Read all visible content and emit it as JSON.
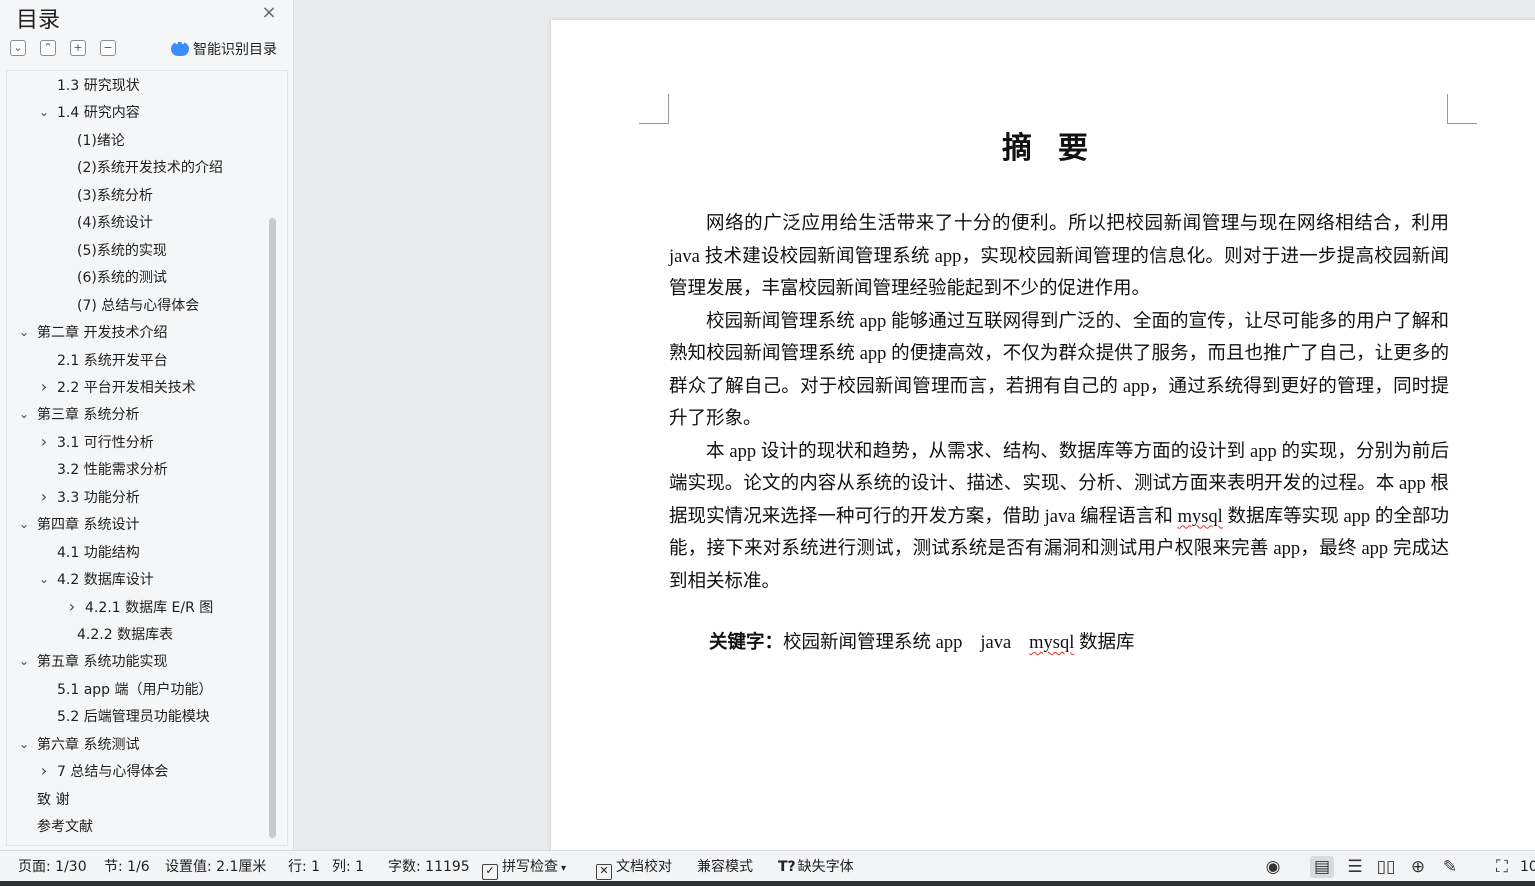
{
  "sidebar": {
    "title": "目录",
    "close_glyph": "×",
    "smart_toc_label": "智能识别目录",
    "toc": [
      {
        "label": "1.3  研究现状",
        "level": 1,
        "chevron": ""
      },
      {
        "label": "1.4  研究内容",
        "level": 1,
        "chevron": "expanded"
      },
      {
        "label": "(1)绪论",
        "level": 2,
        "chevron": ""
      },
      {
        "label": "(2)系统开发技术的介绍",
        "level": 2,
        "chevron": ""
      },
      {
        "label": "(3)系统分析",
        "level": 2,
        "chevron": ""
      },
      {
        "label": "(4)系统设计",
        "level": 2,
        "chevron": ""
      },
      {
        "label": "(5)系统的实现",
        "level": 2,
        "chevron": ""
      },
      {
        "label": "(6)系统的测试",
        "level": 2,
        "chevron": ""
      },
      {
        "label": "(7)  总结与心得体会",
        "level": 2,
        "chevron": ""
      },
      {
        "label": " 第二章  开发技术介绍",
        "level": 0,
        "chevron": "expanded"
      },
      {
        "label": "2.1  系统开发平台",
        "level": 1,
        "chevron": ""
      },
      {
        "label": "2.2  平台开发相关技术",
        "level": 1,
        "chevron": "collapsed"
      },
      {
        "label": "第三章  系统分析",
        "level": 0,
        "chevron": "expanded"
      },
      {
        "label": "3.1  可行性分析",
        "level": 1,
        "chevron": "collapsed"
      },
      {
        "label": "3.2 性能需求分析",
        "level": 1,
        "chevron": ""
      },
      {
        "label": "3.3 功能分析",
        "level": 1,
        "chevron": "collapsed"
      },
      {
        "label": "第四章  系统设计",
        "level": 0,
        "chevron": "expanded"
      },
      {
        "label": "4.1 功能结构",
        "level": 1,
        "chevron": ""
      },
      {
        "label": "4.2  数据库设计",
        "level": 1,
        "chevron": "expanded"
      },
      {
        "label": "4.2.1  数据库 E/R 图",
        "level": 3,
        "chevron": "collapsed"
      },
      {
        "label": "4.2.2  数据库表",
        "level": 2,
        "chevron": ""
      },
      {
        "label": "第五章  系统功能实现",
        "level": 0,
        "chevron": "expanded"
      },
      {
        "label": "5.1 app 端（用户功能）",
        "level": 1,
        "chevron": ""
      },
      {
        "label": "5.2 后端管理员功能模块",
        "level": 1,
        "chevron": ""
      },
      {
        "label": "第六章  系统测试",
        "level": 0,
        "chevron": "expanded"
      },
      {
        "label": "7 总结与心得体会",
        "level": 1,
        "chevron": "collapsed"
      },
      {
        "label": "致    谢",
        "level": 0,
        "chevron": ""
      },
      {
        "label": "参考文献",
        "level": 0,
        "chevron": ""
      }
    ]
  },
  "document": {
    "title": "摘要",
    "paragraphs": [
      "网络的广泛应用给生活带来了十分的便利。所以把校园新闻管理与现在网络相结合，利用 java 技术建设校园新闻管理系统 app，实现校园新闻管理的信息化。则对于进一步提高校园新闻管理发展，丰富校园新闻管理经验能起到不少的促进作用。",
      "校园新闻管理系统 app 能够通过互联网得到广泛的、全面的宣传，让尽可能多的用户了解和熟知校园新闻管理系统 app 的便捷高效，不仅为群众提供了服务，而且也推广了自己，让更多的群众了解自己。对于校园新闻管理而言，若拥有自己的 app，通过系统得到更好的管理，同时提升了形象。"
    ],
    "p3": {
      "a": "本 app 设计的现状和趋势，从需求、结构、数据库等方面的设计到 app 的实现，分别为前后端实现。论文的内容从系统的设计、描述、实现、分析、测试方面来表明开发的过程。本 app 根据现实情况来选择一种可行的开发方案，借助 java 编程语言和 ",
      "spell": "mysql",
      "b": " 数据库等实现 app 的全部功能，接下来对系统进行测试，测试系统是否有漏洞和测试用户权限来完善 app，最终 app 完成达到相关标准。"
    },
    "keywords": {
      "label": "关键字：",
      "k1": "校园新闻管理系统 app",
      "k2": "java",
      "k3_spell": "mysql",
      "k3_rest": " 数据库"
    }
  },
  "statusbar": {
    "page": "页面: 1/30",
    "section": "节: 1/6",
    "setting": "设置值: 2.1厘米",
    "row": "行: 1",
    "col": "列: 1",
    "wordcount": "字数: 11195",
    "spellcheck": "拼写检查",
    "proofread": "文档校对",
    "compat": "兼容模式",
    "missing_font": "缺失字体",
    "zoom_partial": "10"
  }
}
